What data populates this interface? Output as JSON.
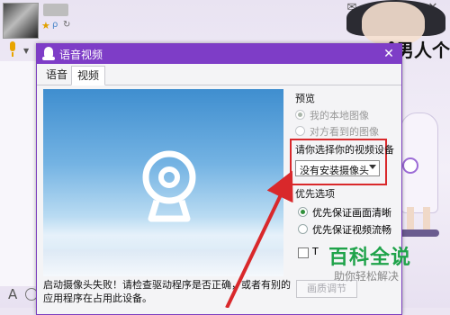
{
  "chat": {
    "status_star": "★",
    "status_a": "ρ",
    "status_b": "↻",
    "window_buttons": [
      "✉",
      "—",
      "□",
      "✕"
    ]
  },
  "decoration": {
    "title": "男人个矮"
  },
  "dialog": {
    "title": "语音视频",
    "close": "✕",
    "tabs": [
      "语音",
      "视频"
    ],
    "active_tab": "视频",
    "status_message": "启动摄像头失败！请检查驱动程序是否正确，或者有别的应用程序在占用此设备。",
    "preview_section": {
      "label": "预览",
      "options": [
        {
          "label": "我的本地图像",
          "checked": true,
          "disabled": true
        },
        {
          "label": "对方看到的图像",
          "checked": false,
          "disabled": true
        }
      ]
    },
    "device_section": {
      "label": "请你选择你的视频设备",
      "selected": "没有安装摄像头"
    },
    "priority_section": {
      "label": "优先选项",
      "options": [
        {
          "label": "优先保证画面清晰",
          "checked": true
        },
        {
          "label": "优先保证视频流畅",
          "checked": false
        }
      ],
      "checkbox_label": "T"
    },
    "adjust_button": "画质调节"
  },
  "watermark": {
    "title": "百科全说",
    "subtitle": "助你轻松解决"
  },
  "colors": {
    "titlebar": "#7e3dc7",
    "highlight": "#d9282b",
    "watermark": "#1fa34a"
  }
}
